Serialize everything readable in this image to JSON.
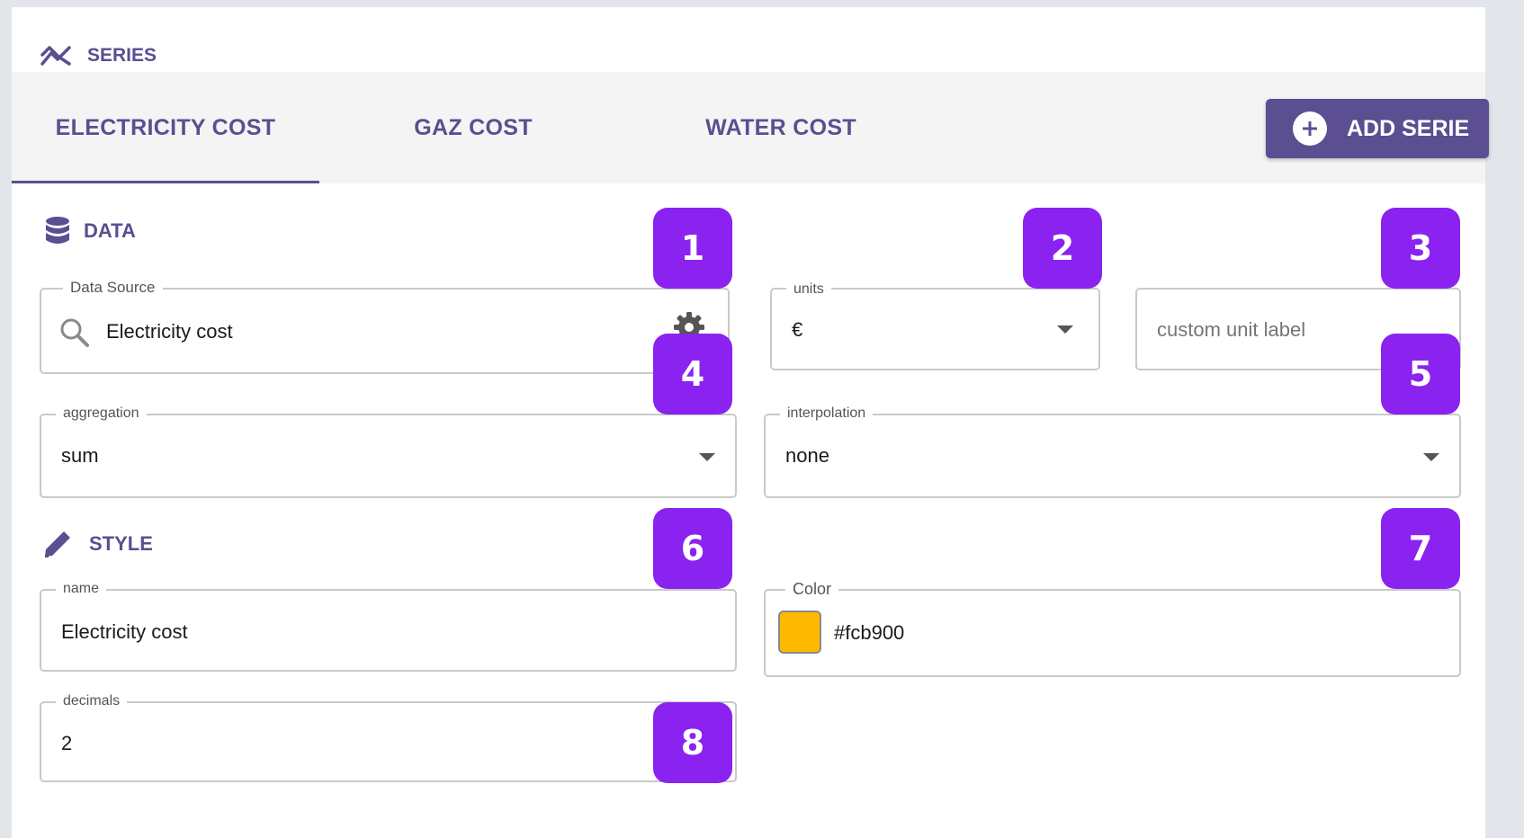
{
  "series_header": {
    "label": "SERIES",
    "icon": "trending-icon"
  },
  "tabs": [
    {
      "label": "ELECTRICITY COST",
      "active": true
    },
    {
      "label": "GAZ COST",
      "active": false
    },
    {
      "label": "WATER COST",
      "active": false
    }
  ],
  "add_button": {
    "label": "ADD SERIE",
    "icon": "plus-circle-icon"
  },
  "data_section": {
    "title": "DATA",
    "icon": "database-icon",
    "data_source": {
      "legend": "Data Source",
      "value": "Electricity cost",
      "search_icon": "search-icon",
      "settings_icon": "gear-icon"
    },
    "units": {
      "legend": "units",
      "value": "€"
    },
    "custom_unit": {
      "placeholder": "custom unit label"
    },
    "aggregation": {
      "legend": "aggregation",
      "value": "sum"
    },
    "interpolation": {
      "legend": "interpolation",
      "value": "none"
    }
  },
  "style_section": {
    "title": "STYLE",
    "icon": "pencil-icon",
    "name": {
      "legend": "name",
      "value": "Electricity cost"
    },
    "color": {
      "legend": "Color",
      "value": "#fcb900",
      "swatch": "#fcb900"
    },
    "decimals": {
      "legend": "decimals",
      "value": "2"
    }
  },
  "badges": [
    "1",
    "2",
    "3",
    "4",
    "5",
    "6",
    "7",
    "8"
  ],
  "colors": {
    "accent": "#5b4e91",
    "badge": "#8a22f0",
    "tab_bar": "#f4f4f4"
  }
}
